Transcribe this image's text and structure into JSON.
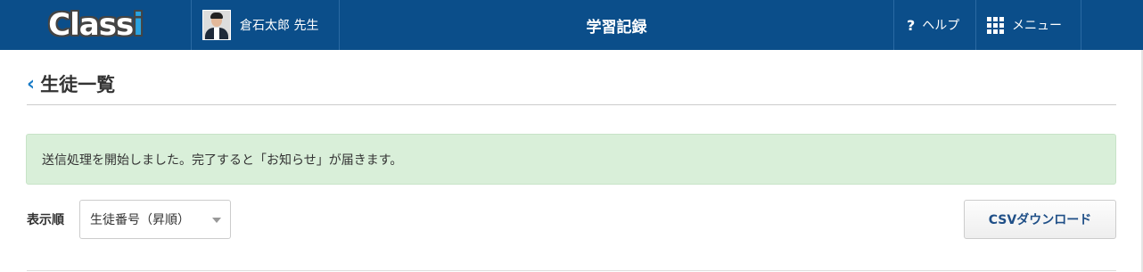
{
  "header": {
    "logo_text": "Class",
    "logo_i": "i",
    "user_name": "倉石太郎 先生",
    "app_title": "学習記録",
    "help_icon": "?",
    "help_label": "ヘルプ",
    "menu_label": "メニュー",
    "brand_color": "#0b4e8a"
  },
  "page": {
    "back_icon": "‹",
    "title": "生徒一覧"
  },
  "notice": {
    "message": "送信処理を開始しました。完了すると「お知らせ」が届きます。",
    "color": "#d9efd9"
  },
  "controls": {
    "sort_label": "表示順",
    "sort_value": "生徒番号（昇順）",
    "csv_button": "CSVダウンロード"
  }
}
